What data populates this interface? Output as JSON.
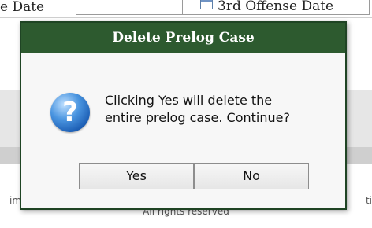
{
  "background": {
    "header_left_fragment": "e Date",
    "header_right_fragment": "3rd Offense Date",
    "footer_left_fragment": "im",
    "footer_right_fragment": "ti",
    "footer_rights_text": "All rights reserved"
  },
  "dialog": {
    "title": "Delete Prelog Case",
    "icon": "question-icon",
    "icon_glyph": "?",
    "message_line1": "Clicking Yes will delete the",
    "message_line2": "entire prelog case. Continue?",
    "yes_label": "Yes",
    "no_label": "No"
  },
  "colors": {
    "titlebar": "#2d5a2f",
    "dialog_border": "#1f4424",
    "icon_blue": "#1d5fb5"
  }
}
